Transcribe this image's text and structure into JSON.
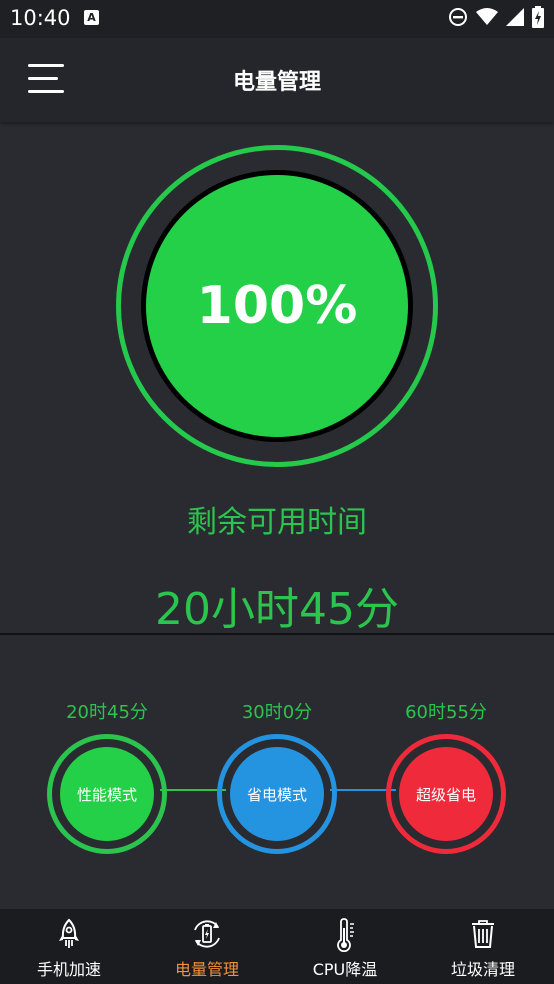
{
  "status_bar": {
    "time": "10:40",
    "notif_letter": "A"
  },
  "app_bar": {
    "title": "电量管理"
  },
  "battery": {
    "percent": "100%",
    "remain_label": "剩余可用时间",
    "remain_time": "20小时45分"
  },
  "modes": [
    {
      "time": "20时45分",
      "label": "性能模式",
      "color": "#24d048",
      "ring": "#2bc44e"
    },
    {
      "time": "30时0分",
      "label": "省电模式",
      "color": "#2493e0",
      "ring": "#2493e0"
    },
    {
      "time": "60时55分",
      "label": "超级省电",
      "color": "#ef2a3a",
      "ring": "#ef2a3a"
    }
  ],
  "nav": [
    {
      "label": "手机加速",
      "icon": "rocket-icon"
    },
    {
      "label": "电量管理",
      "icon": "battery-refresh-icon",
      "active": true
    },
    {
      "label": "CPU降温",
      "icon": "thermometer-icon"
    },
    {
      "label": "垃圾清理",
      "icon": "trash-icon"
    }
  ],
  "colors": {
    "accent_green": "#2bc44e",
    "nav_active": "#f0923a",
    "background": "#2a2b30"
  }
}
